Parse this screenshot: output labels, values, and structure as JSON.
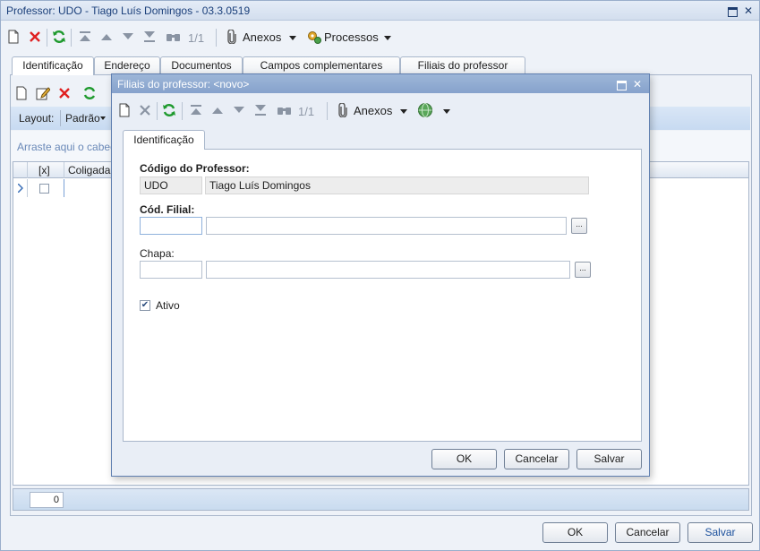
{
  "window": {
    "title": "Professor: UDO - Tiago Luís Domingos - 03.3.0519"
  },
  "main_toolbar": {
    "record_pos": "1/1",
    "anexos": "Anexos",
    "processos": "Processos"
  },
  "tabs": [
    {
      "label": "Identificação"
    },
    {
      "label": "Endereço"
    },
    {
      "label": "Documentos"
    },
    {
      "label": "Campos complementares"
    },
    {
      "label": "Filiais do professor"
    }
  ],
  "grid_area": {
    "layout_label": "Layout:",
    "layout_value": "Padrão",
    "group_hint": "Arraste aqui o cabeça",
    "columns": [
      "[x]",
      "Coligada"
    ],
    "count": "0"
  },
  "modal": {
    "title": "Filiais do professor: <novo>",
    "record_pos": "1/1",
    "anexos": "Anexos",
    "tab": "Identificação",
    "codigo_professor_label": "Código do Professor:",
    "codigo_professor_code": "UDO",
    "codigo_professor_name": "Tiago Luís Domingos",
    "cod_filial_label": "Cód. Filial:",
    "cod_filial_value": "",
    "cod_filial_desc": "",
    "chapa_label": "Chapa:",
    "chapa_value": "",
    "chapa_desc": "",
    "lookup_label": "...",
    "ativo_label": "Ativo",
    "ativo_checked": true,
    "buttons": {
      "ok": "OK",
      "cancel": "Cancelar",
      "save": "Salvar"
    }
  },
  "main_buttons": {
    "ok": "OK",
    "cancel": "Cancelar",
    "save": "Salvar"
  },
  "colors": {
    "accent": "#1a4f9c",
    "delete_red": "#e02020",
    "refresh_green": "#1f9a2e"
  }
}
